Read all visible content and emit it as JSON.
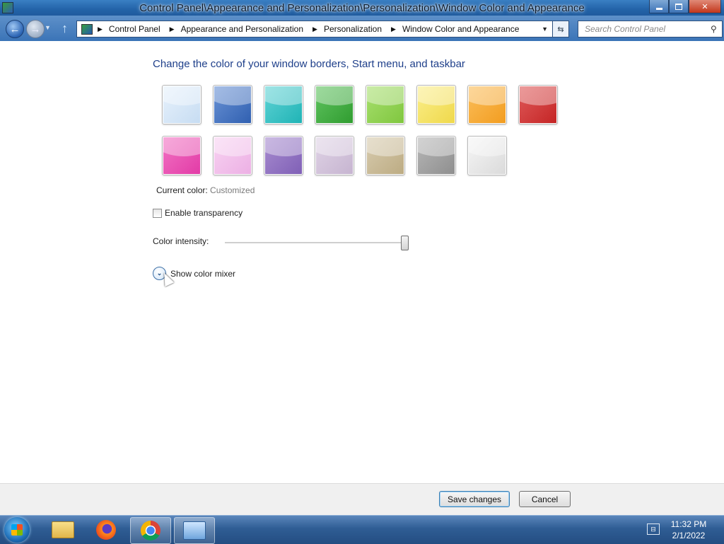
{
  "window": {
    "title": "Control Panel\\Appearance and Personalization\\Personalization\\Window Color and Appearance"
  },
  "address": {
    "breadcrumbs": [
      "Control Panel",
      "Appearance and Personalization",
      "Personalization",
      "Window Color and Appearance"
    ]
  },
  "search": {
    "placeholder": "Search Control Panel"
  },
  "content": {
    "heading": "Change the color of your window borders, Start menu, and taskbar",
    "swatches": [
      {
        "color": "#e8f2fc",
        "edge": "#c6dcf2"
      },
      {
        "color": "#6c94d6",
        "edge": "#2f5fb0"
      },
      {
        "color": "#62d4d6",
        "edge": "#1fb3b5"
      },
      {
        "color": "#62c462",
        "edge": "#2f9c2f"
      },
      {
        "color": "#a9e070",
        "edge": "#7fc63e"
      },
      {
        "color": "#fbef8c",
        "edge": "#efd84a"
      },
      {
        "color": "#fbbf5c",
        "edge": "#f29c1f"
      },
      {
        "color": "#e05c5c",
        "edge": "#c42424"
      },
      {
        "color": "#f275c4",
        "edge": "#e23aa6"
      },
      {
        "color": "#f8d4f2",
        "edge": "#ecafe4"
      },
      {
        "color": "#a98ed0",
        "edge": "#7f5fb6"
      },
      {
        "color": "#e0d4e6",
        "edge": "#c6b4d0"
      },
      {
        "color": "#d8ccb0",
        "edge": "#bcab82"
      },
      {
        "color": "#b8b8b8",
        "edge": "#8e8e8e"
      },
      {
        "color": "#f6f6f6",
        "edge": "#dadada"
      }
    ],
    "current_color_label": "Current color:",
    "current_color_value": "Customized",
    "transparency_label": "Enable transparency",
    "transparency_checked": false,
    "intensity_label": "Color intensity:",
    "intensity_value": 1.0,
    "mixer_label": "Show color mixer"
  },
  "buttons": {
    "save": "Save changes",
    "cancel": "Cancel"
  },
  "taskbar": {
    "items": [
      "windows-explorer-icon",
      "firefox-icon",
      "chrome-icon",
      "control-panel-icon"
    ],
    "time": "11:32 PM",
    "date": "2/1/2022"
  }
}
